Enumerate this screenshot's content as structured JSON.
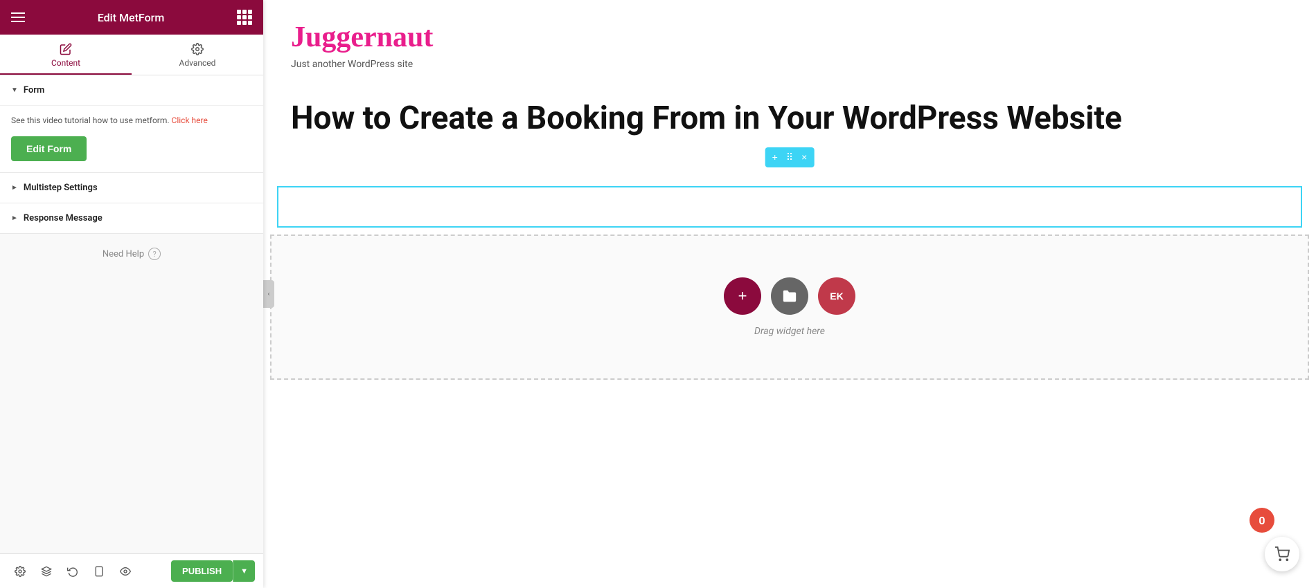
{
  "sidebar": {
    "header": {
      "title": "Edit MetForm",
      "hamburger_label": "hamburger menu",
      "grid_label": "grid menu"
    },
    "tabs": [
      {
        "id": "content",
        "label": "Content",
        "active": true
      },
      {
        "id": "advanced",
        "label": "Advanced",
        "active": false
      }
    ],
    "sections": [
      {
        "id": "form",
        "title": "Form",
        "expanded": true,
        "tutorial_text": "See this video tutorial how to use metform.",
        "tutorial_link_text": "Click here",
        "edit_form_label": "Edit Form"
      },
      {
        "id": "multistep",
        "title": "Multistep Settings",
        "expanded": false
      },
      {
        "id": "response",
        "title": "Response Message",
        "expanded": false
      }
    ],
    "need_help": "Need Help",
    "footer": {
      "publish_label": "PUBLISH",
      "publish_arrow": "▼"
    }
  },
  "canvas": {
    "site_title": "Juggernaut",
    "site_subtitle": "Just another WordPress site",
    "page_heading": "How to Create a Booking From in Your WordPress Website",
    "widget_toolbar": {
      "add_icon": "+",
      "move_icon": "⠿",
      "close_icon": "×"
    },
    "drag_area": {
      "text": "Drag widget here",
      "buttons": [
        {
          "type": "add",
          "icon": "+",
          "color_class": "red"
        },
        {
          "type": "folder",
          "icon": "🗁",
          "color_class": "gray"
        },
        {
          "type": "ek",
          "icon": "EK",
          "color_class": "pink"
        }
      ]
    }
  },
  "notification": {
    "badge_count": "0"
  },
  "icons": {
    "pencil": "✏",
    "gear": "⚙",
    "settings": "⚙",
    "layers": "⧉",
    "history": "↺",
    "responsive": "▣",
    "eye": "👁",
    "cart": "🛒",
    "chevron_left": "‹",
    "question": "?"
  }
}
